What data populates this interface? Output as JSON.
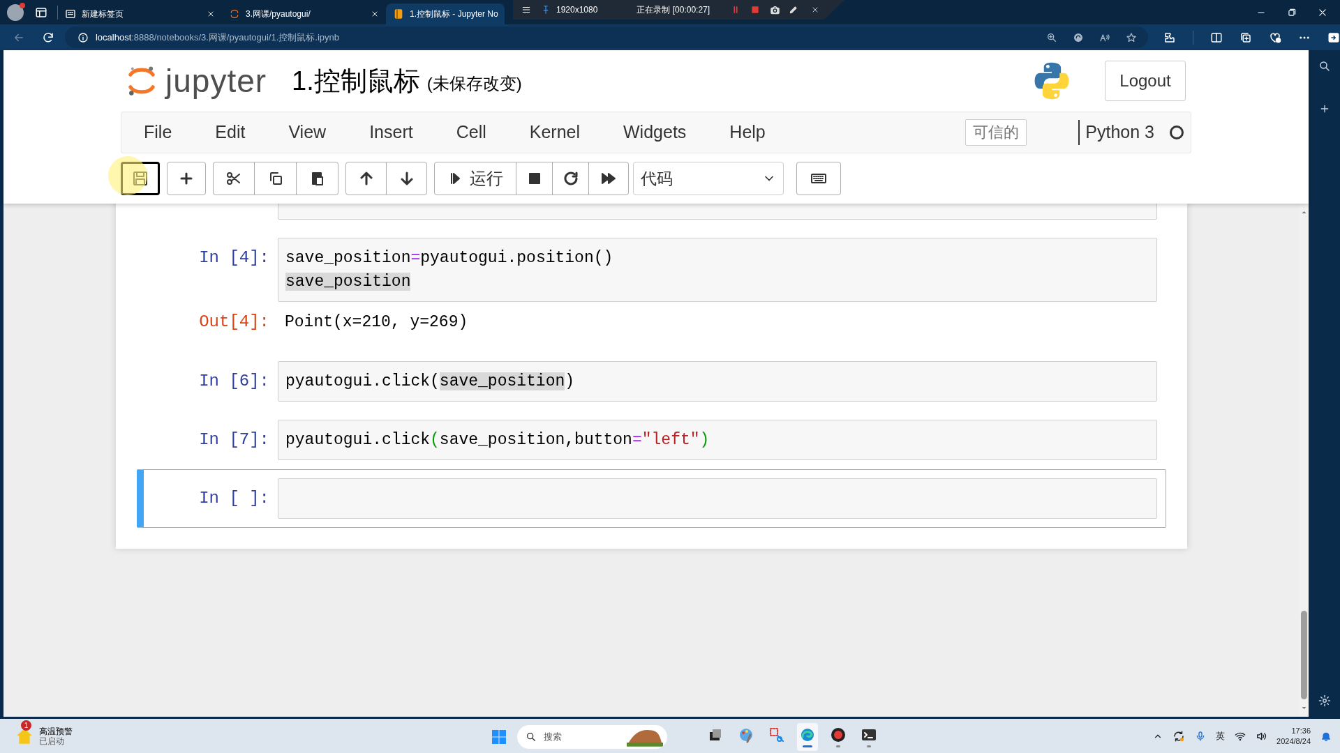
{
  "browser": {
    "tabs": [
      {
        "title": "新建标签页",
        "kind": "newtab",
        "selected": false
      },
      {
        "title": "3.网课/pyautogui/",
        "kind": "jupyter",
        "selected": false
      },
      {
        "title": "1.控制鼠标 - Jupyter No",
        "kind": "notebook",
        "selected": true
      }
    ],
    "address": {
      "host": "localhost",
      "rest": ":8888/notebooks/3.网课/pyautogui/1.控制鼠标.ipynb"
    }
  },
  "recorder": {
    "resolution": "1920x1080",
    "status": "正在录制 [00:00:27]"
  },
  "notebook": {
    "brand": "jupyter",
    "title": "1.控制鼠标",
    "save_status": "(未保存改变)",
    "logout": "Logout",
    "menu": [
      "File",
      "Edit",
      "View",
      "Insert",
      "Cell",
      "Kernel",
      "Widgets",
      "Help"
    ],
    "trusted": "可信的",
    "kernel": "Python 3",
    "toolbar": {
      "run": "运行",
      "cell_type": "代码"
    },
    "cells": [
      {
        "kind": "code_tail",
        "selected": false
      },
      {
        "kind": "code",
        "prompt": "In [4]:",
        "selected": false,
        "lines": [
          [
            {
              "text": "save_position",
              "kind": "name"
            },
            {
              "text": "=",
              "kind": "operator"
            },
            {
              "text": "pyautogui.position()",
              "kind": "name"
            }
          ],
          [
            {
              "text": "save_position",
              "kind": "highlight"
            }
          ]
        ],
        "output": {
          "prompt": "Out[4]:",
          "text": "Point(x=210, y=269)"
        }
      },
      {
        "kind": "code",
        "prompt": "In [6]:",
        "selected": false,
        "lines": [
          [
            {
              "text": "pyautogui.click(",
              "kind": "name"
            },
            {
              "text": "save_position",
              "kind": "highlight"
            },
            {
              "text": ")",
              "kind": "name"
            }
          ]
        ]
      },
      {
        "kind": "code",
        "prompt": "In [7]:",
        "selected": false,
        "lines": [
          [
            {
              "text": "pyautogui.click",
              "kind": "name"
            },
            {
              "text": "(",
              "kind": "bracket"
            },
            {
              "text": "save_position,button",
              "kind": "name"
            },
            {
              "text": "=",
              "kind": "operator"
            },
            {
              "text": "\"left\"",
              "kind": "string"
            },
            {
              "text": ")",
              "kind": "bracket"
            }
          ]
        ]
      },
      {
        "kind": "code",
        "prompt": "In [ ]:",
        "selected": true
      }
    ]
  },
  "taskbar": {
    "weather": {
      "badge": "1",
      "title": "高温预警",
      "subtitle": "已启动"
    },
    "search": {
      "placeholder": "搜索"
    },
    "apps": [
      {
        "kind": "files",
        "selected": false,
        "running": false
      },
      {
        "kind": "paint",
        "selected": false,
        "running": false
      },
      {
        "kind": "snip",
        "selected": false,
        "running": false
      },
      {
        "kind": "edge",
        "selected": true,
        "running": true
      },
      {
        "kind": "record",
        "selected": false,
        "running": true
      },
      {
        "kind": "terminal",
        "selected": false,
        "running": true
      }
    ],
    "language": "英",
    "time": "17:36",
    "date": "2024/8/24"
  }
}
